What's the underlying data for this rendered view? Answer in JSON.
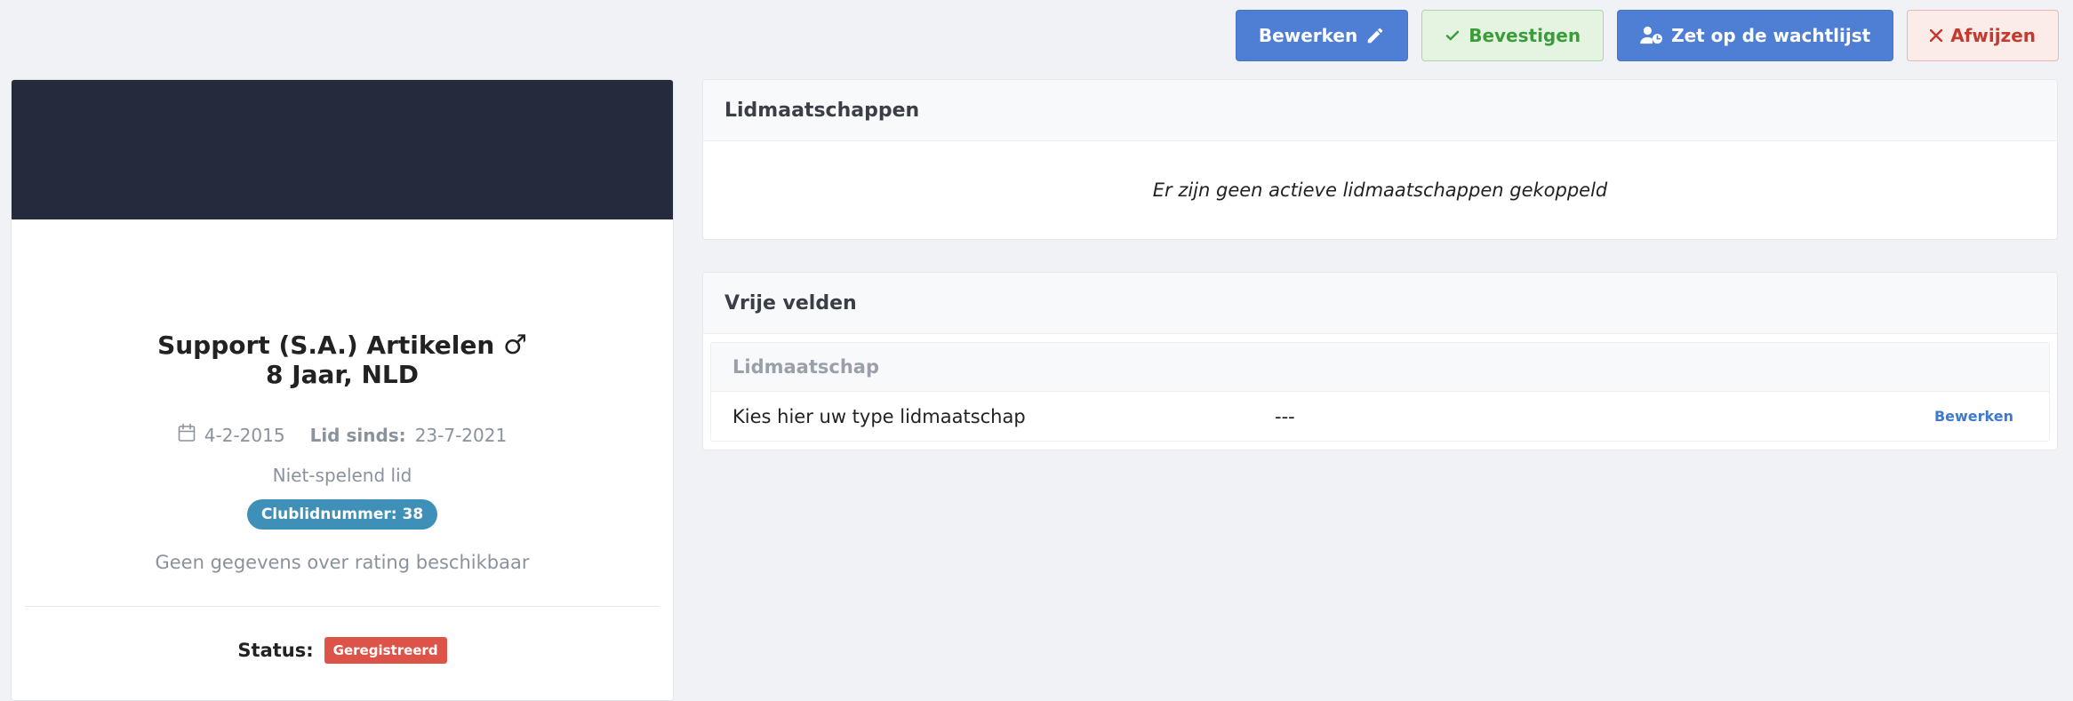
{
  "toolbar": {
    "edit_label": "Bewerken",
    "confirm_label": "Bevestigen",
    "waitlist_label": "Zet op de wachtlijst",
    "reject_label": "Afwijzen"
  },
  "profile": {
    "name": "Support (S.A.) Artikelen",
    "gender_symbol": "♂",
    "age_country": "8 Jaar, NLD",
    "birthdate": "4-2-2015",
    "member_since_label": "Lid sinds:",
    "member_since": "23-7-2021",
    "member_type": "Niet-spelend lid",
    "club_number": "Clublidnummer: 38",
    "rating_text": "Geen gegevens over rating beschikbaar",
    "status_label": "Status:",
    "status_value": "Geregistreerd"
  },
  "memberships": {
    "title": "Lidmaatschappen",
    "empty_text": "Er zijn geen actieve lidmaatschappen gekoppeld"
  },
  "free_fields": {
    "title": "Vrije velden",
    "group_title": "Lidmaatschap",
    "rows": [
      {
        "label": "Kies hier uw type lidmaatschap",
        "value": "---",
        "action": "Bewerken"
      }
    ]
  },
  "colors": {
    "primary": "#4f7fd4",
    "success": "#3a9d3a",
    "danger": "#c23b2e",
    "banner": "#242b3d",
    "club_badge": "#3f90b8",
    "status_badge": "#dd5349"
  }
}
